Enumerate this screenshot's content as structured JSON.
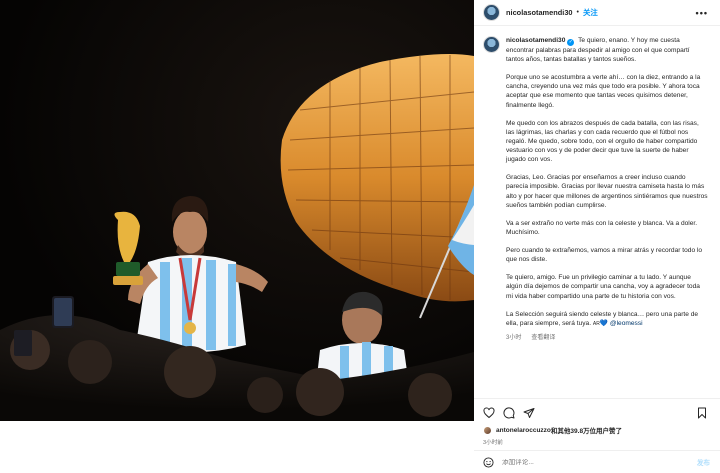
{
  "post": {
    "username": "nicolasotamendi30",
    "follow_label": "关注",
    "more_label": "•••"
  },
  "caption": {
    "username": "nicolasotamendi30",
    "paragraphs": [
      "Te quiero, enano. Y hoy me cuesta encontrar palabras para despedir al amigo con el que compartí tantos años, tantas batallas y tantos sueños.",
      "Porque uno se acostumbra a verte ahí… con la diez, entrando a la cancha, creyendo una vez más que todo era posible. Y ahora toca aceptar que ese momento que tantas veces quisimos detener, finalmente llegó.",
      "Me quedo con los abrazos después de cada batalla, con las risas, las lágrimas, las charlas y con cada recuerdo que el fútbol nos regaló. Me quedo, sobre todo, con el orgullo de haber compartido vestuario con vos y de poder decir que tuve la suerte de haber jugado con vos.",
      "Gracias, Leo. Gracias por enseñarnos a creer incluso cuando parecía imposible. Gracias por llevar nuestra camiseta hasta lo más alto y por hacer que millones de argentinos sintiéramos que nuestros sueños también podían cumplirse.",
      "Va a ser extraño no verte más con la celeste y blanca. Va a doler. Muchísimo.",
      "Pero cuando te extrañemos, vamos a mirar atrás y recordar todo lo que nos diste.",
      "Te quiero, amigo. Fue un privilegio caminar a tu lado. Y aunque algún día dejemos de compartir una cancha, voy a agradecer toda mi vida haber compartido una parte de tu historia con vos."
    ],
    "last_text": "La Selección seguirá siendo celeste y blanca… pero una parte de ella, para siempre, será tuya.",
    "flag_text": "AR",
    "heart": "💙",
    "mention": "@leomessi",
    "time": "3小时",
    "translate_label": "查看翻译"
  },
  "likes": {
    "liker": "antonelaroccuzzo",
    "suffix": "和其他39.8万位用户赞了",
    "time_ago": "3小时前"
  },
  "comment": {
    "placeholder": "添加评论...",
    "post_label": "发布"
  },
  "icons": {
    "like": "heart-icon",
    "comment": "comment-icon",
    "share": "send-icon",
    "save": "bookmark-icon",
    "emoji": "emoji-icon",
    "more": "more-icon"
  },
  "colors": {
    "link_blue": "#0095f6",
    "mention": "#00376b",
    "muted": "#737373",
    "stadium_gold": "#e8a648"
  }
}
